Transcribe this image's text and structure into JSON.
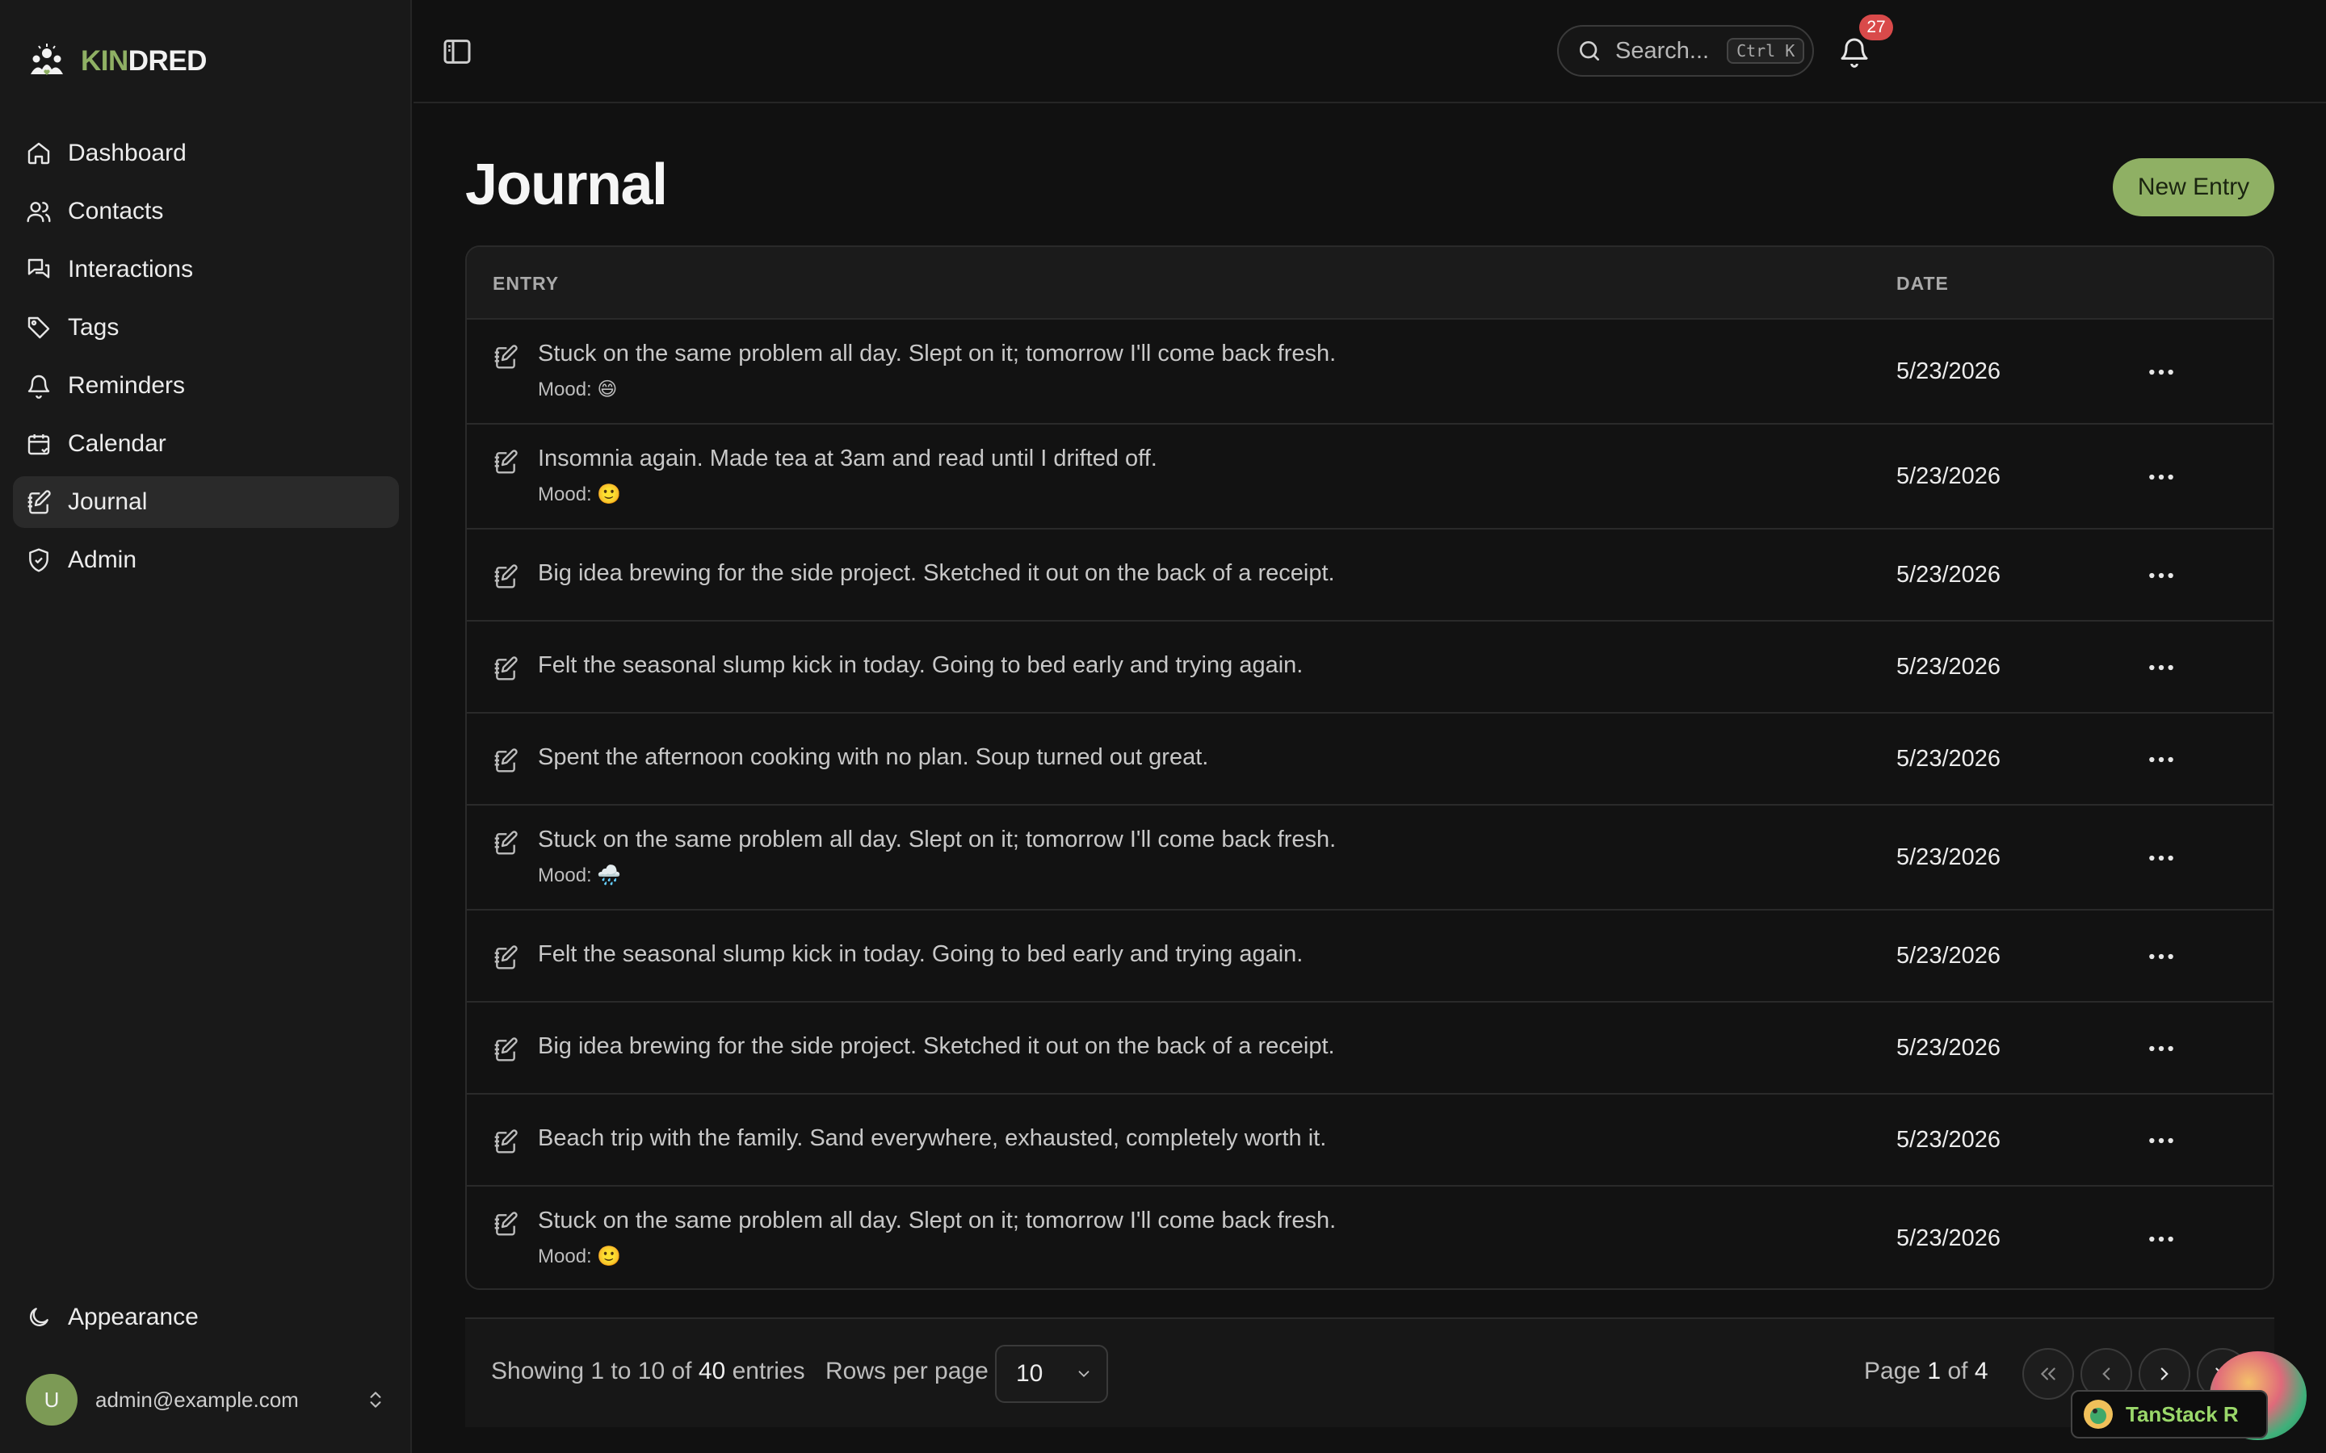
{
  "brand": {
    "part1": "KIN",
    "part2": "DRED"
  },
  "sidebar": {
    "items": [
      {
        "label": "Dashboard",
        "icon": "home-icon"
      },
      {
        "label": "Contacts",
        "icon": "users-icon"
      },
      {
        "label": "Interactions",
        "icon": "messages-icon"
      },
      {
        "label": "Tags",
        "icon": "tag-icon"
      },
      {
        "label": "Reminders",
        "icon": "bell-icon"
      },
      {
        "label": "Calendar",
        "icon": "calendar-icon"
      },
      {
        "label": "Journal",
        "icon": "notebook-pen-icon",
        "active": true
      },
      {
        "label": "Admin",
        "icon": "shield-check-icon"
      }
    ],
    "appearance_label": "Appearance",
    "user": {
      "initial": "U",
      "email": "admin@example.com"
    }
  },
  "topbar": {
    "search_placeholder": "Search...",
    "search_shortcut": "Ctrl K",
    "notification_count": "27"
  },
  "page": {
    "title": "Journal",
    "new_entry_label": "New Entry"
  },
  "table": {
    "columns": {
      "entry": "ENTRY",
      "date": "DATE"
    },
    "rows": [
      {
        "text": "Stuck on the same problem all day. Slept on it; tomorrow I'll come back fresh.",
        "mood": "Mood: 😄",
        "date": "5/23/2026"
      },
      {
        "text": "Insomnia again. Made tea at 3am and read until I drifted off.",
        "mood": "Mood: 🙂",
        "date": "5/23/2026"
      },
      {
        "text": "Big idea brewing for the side project. Sketched it out on the back of a receipt.",
        "mood": "",
        "date": "5/23/2026"
      },
      {
        "text": "Felt the seasonal slump kick in today. Going to bed early and trying again.",
        "mood": "",
        "date": "5/23/2026"
      },
      {
        "text": "Spent the afternoon cooking with no plan. Soup turned out great.",
        "mood": "",
        "date": "5/23/2026"
      },
      {
        "text": "Stuck on the same problem all day. Slept on it; tomorrow I'll come back fresh.",
        "mood": "Mood: 🌧️",
        "date": "5/23/2026"
      },
      {
        "text": "Felt the seasonal slump kick in today. Going to bed early and trying again.",
        "mood": "",
        "date": "5/23/2026"
      },
      {
        "text": "Big idea brewing for the side project. Sketched it out on the back of a receipt.",
        "mood": "",
        "date": "5/23/2026"
      },
      {
        "text": "Beach trip with the family. Sand everywhere, exhausted, completely worth it.",
        "mood": "",
        "date": "5/23/2026"
      },
      {
        "text": "Stuck on the same problem all day. Slept on it; tomorrow I'll come back fresh.",
        "mood": "Mood: 🙂",
        "date": "5/23/2026"
      }
    ]
  },
  "pagination": {
    "showing_prefix": "Showing 1 to 10 of",
    "total": "40",
    "showing_suffix": "entries",
    "rows_per_page_label": "Rows per page",
    "rows_per_page_value": "10",
    "page_prefix": "Page",
    "current_page": "1",
    "page_of": "of",
    "total_pages": "4"
  },
  "devtools": {
    "label": "TanStack R"
  },
  "colors": {
    "accent": "#8fb064",
    "badge": "#d94a4a",
    "background": "#111111",
    "sidebar": "#191919"
  }
}
